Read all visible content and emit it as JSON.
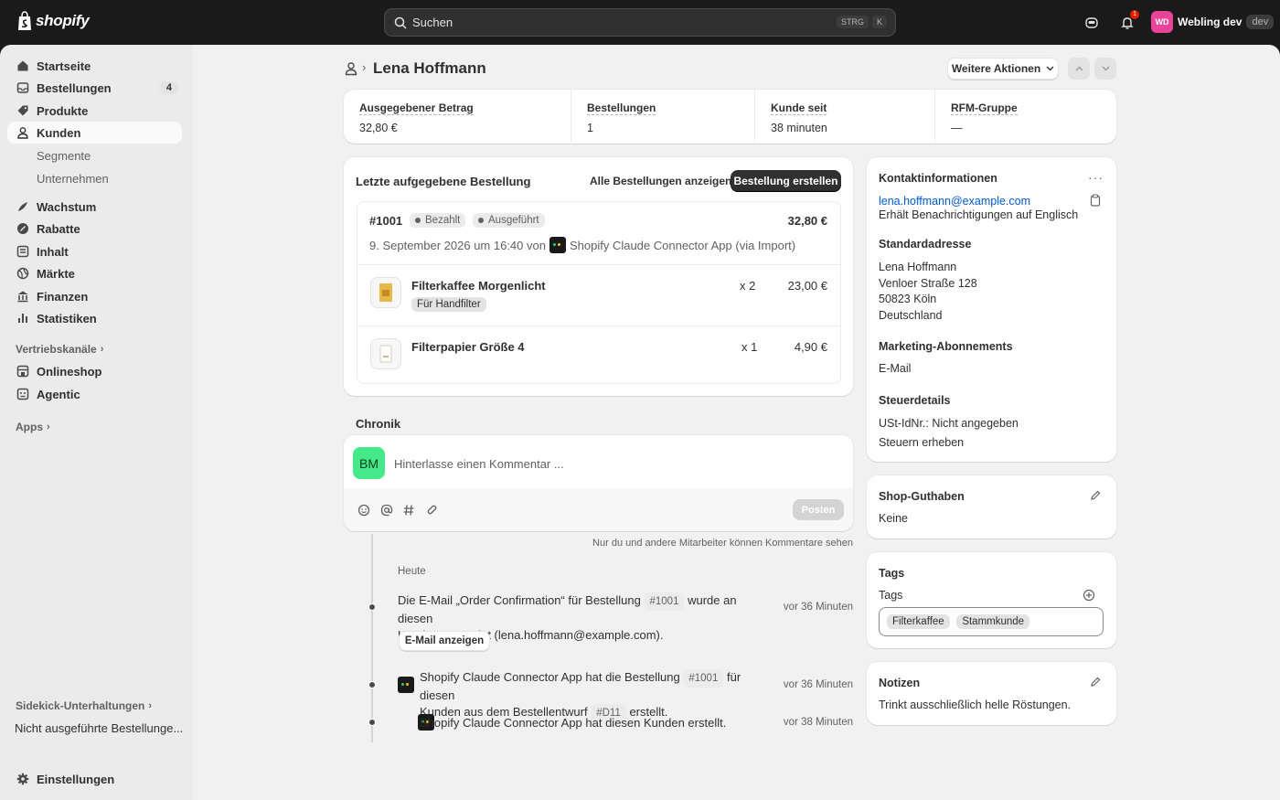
{
  "topbar": {
    "brand": "shopify",
    "search_placeholder": "Suchen",
    "shortcut_mod": "STRG",
    "shortcut_key": "K",
    "notification_count": "1",
    "store_initials": "WD",
    "store_name": "Webling dev",
    "store_tag": "dev"
  },
  "sidebar": {
    "items": [
      {
        "label": "Startseite",
        "icon": "home-icon"
      },
      {
        "label": "Bestellungen",
        "icon": "inbox-icon",
        "badge": "4"
      },
      {
        "label": "Produkte",
        "icon": "tag-icon"
      },
      {
        "label": "Kunden",
        "icon": "person-icon"
      }
    ],
    "sub_items": [
      "Segmente",
      "Unternehmen"
    ],
    "items2": [
      {
        "label": "Wachstum",
        "icon": "growth-icon"
      },
      {
        "label": "Rabatte",
        "icon": "discount-icon"
      },
      {
        "label": "Inhalt",
        "icon": "content-icon"
      },
      {
        "label": "Märkte",
        "icon": "globe-icon"
      },
      {
        "label": "Finanzen",
        "icon": "bank-icon"
      },
      {
        "label": "Statistiken",
        "icon": "chart-icon"
      }
    ],
    "sales_channels_label": "Vertriebskanäle",
    "channels": [
      {
        "label": "Onlineshop",
        "icon": "store-icon"
      },
      {
        "label": "Agentic",
        "icon": "agentic-icon"
      }
    ],
    "apps_label": "Apps",
    "sidekick_label": "Sidekick-Unterhaltungen",
    "sidekick_item": "Nicht ausgeführte Bestellunge...",
    "settings_label": "Einstellungen"
  },
  "header": {
    "title": "Lena Hoffmann",
    "more_actions": "Weitere Aktionen"
  },
  "metrics": [
    {
      "label": "Ausgegebener Betrag",
      "value": "32,80 €"
    },
    {
      "label": "Bestellungen",
      "value": "1"
    },
    {
      "label": "Kunde seit",
      "value": "38 minuten"
    },
    {
      "label": "RFM-Gruppe",
      "value": "—"
    }
  ],
  "last_order": {
    "heading": "Letzte aufgegebene Bestellung",
    "view_all": "Alle Bestellungen anzeigen",
    "create": "Bestellung erstellen",
    "number": "#1001",
    "status_paid": "Bezahlt",
    "status_fulfilled": "Ausgeführt",
    "total": "32,80 €",
    "meta_prefix": "9. September 2026 um 16:40 von",
    "meta_source": "Shopify Claude Connector App (via Import)",
    "items": [
      {
        "name": "Filterkaffee Morgenlicht",
        "variant": "Für Handfilter",
        "qty": "x 2",
        "price": "23,00 €"
      },
      {
        "name": "Filterpapier Größe 4",
        "variant": "",
        "qty": "x 1",
        "price": "4,90 €"
      }
    ]
  },
  "timeline": {
    "heading": "Chronik",
    "avatar": "BM",
    "comment_placeholder": "Hinterlasse einen Kommentar ...",
    "post": "Posten",
    "visibility_note": "Nur du und andere Mitarbeiter können Kommentare sehen",
    "day": "Heute",
    "events": [
      {
        "text_a": "Die E-Mail „Order Confirmation“ für Bestellung",
        "ref": "#1001",
        "text_b": "wurde an diesen",
        "text_c": "Kunden gesendet (lena.hoffmann@example.com).",
        "button": "E-Mail anzeigen",
        "time": "vor 36 Minuten"
      },
      {
        "text_a": "Shopify Claude Connector App hat die Bestellung",
        "ref": "#1001",
        "text_b": "für diesen",
        "text_c": "Kunden aus dem Bestellentwurf",
        "ref2": "#D11",
        "text_d": "erstellt.",
        "time": "vor 36 Minuten"
      },
      {
        "text_a": "Shopify Claude Connector App hat diesen Kunden erstellt.",
        "time": "vor 38 Minuten"
      }
    ]
  },
  "contact": {
    "heading": "Kontaktinformationen",
    "email": "lena.hoffmann@example.com",
    "language_note": "Erhält Benachrichtigungen auf Englisch",
    "address_heading": "Standardadresse",
    "address": [
      "Lena Hoffmann",
      "Venloer Straße 128",
      "50823 Köln",
      "Deutschland"
    ],
    "marketing_heading": "Marketing-Abonnements",
    "marketing_value": "E-Mail",
    "tax_heading": "Steuerdetails",
    "tax_id": "USt-IdNr.: Nicht angegeben",
    "tax_collect": "Steuern erheben"
  },
  "store_credit": {
    "heading": "Shop-Guthaben",
    "value": "Keine"
  },
  "tags": {
    "heading": "Tags",
    "label": "Tags",
    "values": [
      "Filterkaffee",
      "Stammkunde"
    ]
  },
  "notes": {
    "heading": "Notizen",
    "value": "Trinkt ausschließlich helle Röstungen."
  }
}
